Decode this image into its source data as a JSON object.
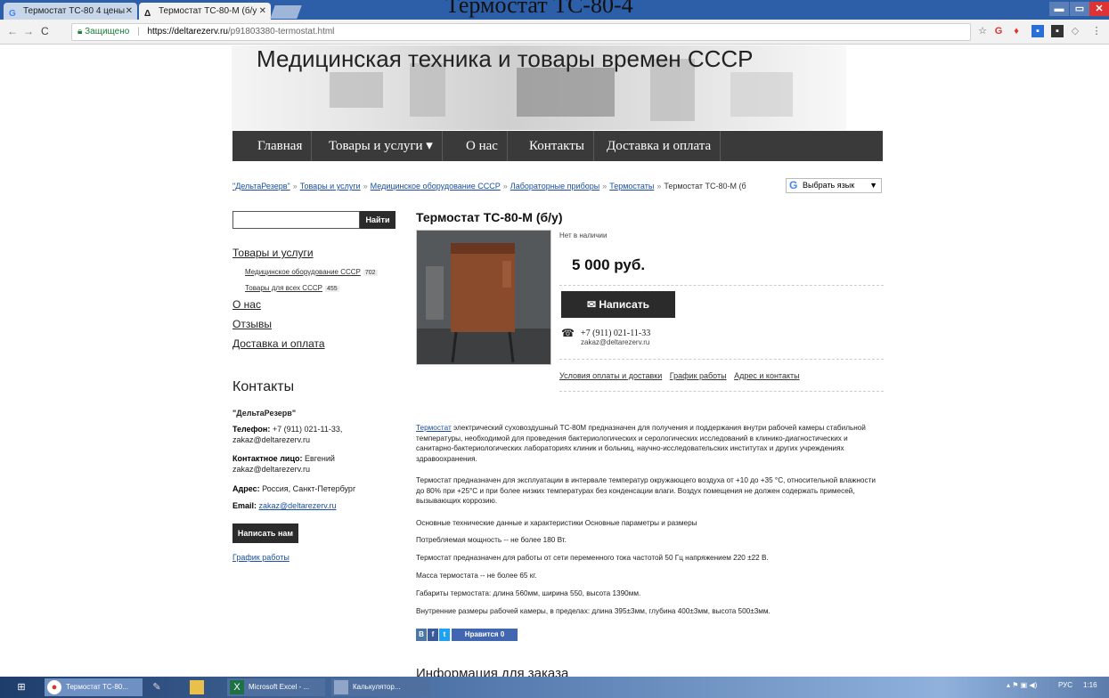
{
  "window": {
    "floating_title": "Термостат ТС-80-4"
  },
  "tabs": [
    {
      "label": "Термостат ТС-80 4 цены",
      "favicon": "G",
      "active": false
    },
    {
      "label": "Термостат ТС-80-М (б/у",
      "favicon": "Δ",
      "active": true
    }
  ],
  "address_bar": {
    "secure_label": "Защищено",
    "url_host": "https://deltarezerv.ru",
    "url_path": "/p91803380-termostat.html"
  },
  "site": {
    "title": "Медицинская техника и товары времен СССР"
  },
  "menu": [
    {
      "label": "Главная"
    },
    {
      "label": "Товары и услуги ▾"
    },
    {
      "label": "О нас"
    },
    {
      "label": "Контакты"
    },
    {
      "label": "Доставка и оплата"
    }
  ],
  "breadcrumbs": {
    "items": [
      "\"ДельтаРезерв\"",
      "Товары и услуги",
      "Медицинское оборудование СССР",
      "Лабораторные приборы",
      "Термостаты"
    ],
    "current": "Термостат ТС-80-М (б",
    "language_label": "Выбрать язык",
    "language_icon": "google-g-icon"
  },
  "sidebar": {
    "search_button": "Найти",
    "links": [
      {
        "label": "Товары и услуги",
        "level": 1
      },
      {
        "label": "Медицинское оборудование СССР",
        "count": "702",
        "level": 2
      },
      {
        "label": "Товары для всех СССР",
        "count": "455",
        "level": 2
      },
      {
        "label": "О нас",
        "level": 1
      },
      {
        "label": "Отзывы",
        "level": 1
      },
      {
        "label": "Доставка и оплата",
        "level": 1
      }
    ],
    "contacts": {
      "heading": "Контакты",
      "company": "\"ДельтаРезерв\"",
      "phone_label": "Телефон:",
      "phone_value": "+7 (911) 021-11-33,",
      "phone_email": "zakaz@deltarezerv.ru",
      "person_label": "Контактное лицо:",
      "person_value": "Евгений",
      "person_email": "zakaz@deltarezerv.ru",
      "address_label": "Адрес:",
      "address_value": "Россия, Санкт-Петербург",
      "email_label": "Email:",
      "email_value": "zakaz@deltarezerv.ru",
      "write_us": "Написать нам",
      "schedule": "График работы"
    }
  },
  "product": {
    "title": "Термостат ТС-80-М (б/у)",
    "stock": "Нет в наличии",
    "price": "5 000 руб.",
    "write_button": "Написать",
    "phone": "+7 (911) 021-11-33",
    "email": "zakaz@deltarezerv.ru",
    "info_links": [
      "Условия оплаты и доставки",
      "График работы",
      "Адрес и контакты"
    ]
  },
  "description": {
    "link_word": "Термостат",
    "p1": " электрический суховоздушный ТС-80М предназначен для получения и поддержания внутри рабочей камеры стабильной температуры, необходимой для проведения бактериологических и серологических исследований в клинико-диагностических и санитарно-бактериологических лабораториях клиник и больниц, научно-исследовательских институтах и других учреждениях здравоохранения.",
    "p2": "Термостат предназначен для эксплуатации в интервале температур окружающего воздуха от +10 до +35 °С, относительной влажности до 80% при +25°С и при более низких температурах без конденсации влаги. Воздух помещения не должен содержать примесей, вызывающих коррозию.",
    "p3": "Основные технические данные и характеристики Основные параметры и размеры",
    "p4": "Потребляемая мощность -- не более 180 Вт.",
    "p5": "Термостат предназначен для работы от сети переменного тока частотой 50 Гц напряжением 220 ±22 В.",
    "p6": "Масса термостата -- не более 65 кг.",
    "p7": "Габариты термостата: длина 560мм, ширина 550, высота 1390мм.",
    "p8": "Внутренние размеры рабочей камеры, в пределах: длина 395±3мм, глубина 400±3мм, высота 500±3мм."
  },
  "social": {
    "vk": "В",
    "fb": "f",
    "tw": "t",
    "like": "Нравится 0"
  },
  "order_heading": "Информация для заказа",
  "taskbar": {
    "items": [
      {
        "label": "Термостат ТС-80..."
      },
      {
        "label": ""
      },
      {
        "label": ""
      },
      {
        "label": "Microsoft Excel - ..."
      },
      {
        "label": "Калькулятор..."
      }
    ],
    "lang": "РУС",
    "time": "1:16"
  }
}
